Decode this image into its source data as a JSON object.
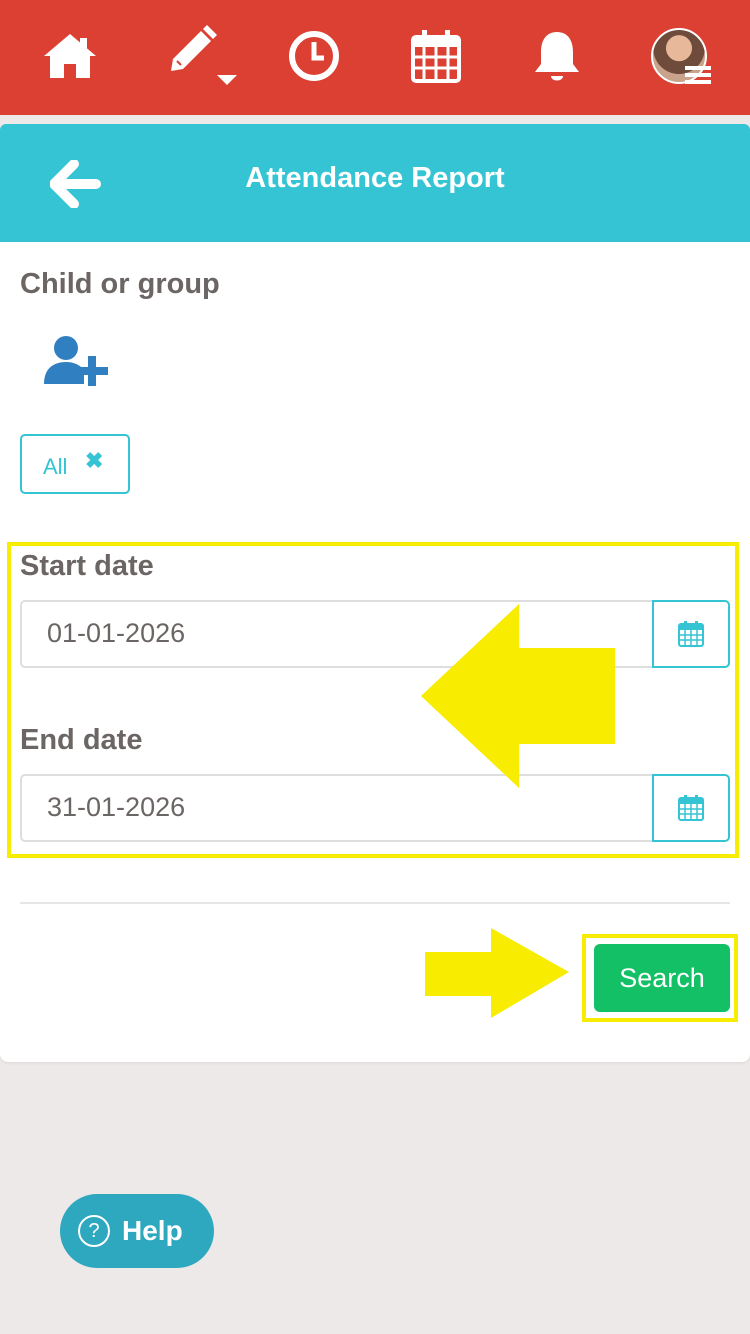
{
  "nav": {
    "icons": [
      "home-icon",
      "edit-icon",
      "clock-icon",
      "calendar-icon",
      "bell-icon",
      "avatar-menu-icon"
    ],
    "accent": "#db4033"
  },
  "header": {
    "title": "Attendance Report",
    "color": "#35c4d4"
  },
  "form": {
    "child_label": "Child or group",
    "selected_chip": "All",
    "chip_remove_glyph": "✖",
    "start_label": "Start date",
    "start_value": "01-01-2026",
    "end_label": "End date",
    "end_value": "31-01-2026",
    "search_label": "Search",
    "search_color": "#14c065",
    "highlight_color": "#f8ed00"
  },
  "help": {
    "icon_glyph": "?",
    "label": "Help",
    "color": "#2ea8bf"
  }
}
